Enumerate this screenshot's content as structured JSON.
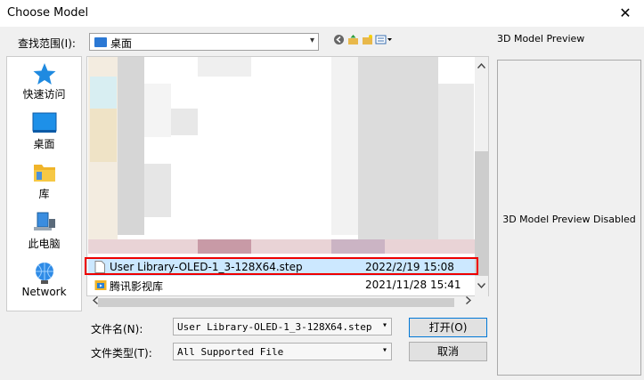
{
  "window": {
    "title": "Choose Model",
    "close_label": "✕"
  },
  "toolbar": {
    "look_in_label": "查找范围(I):",
    "look_in_value": "桌面"
  },
  "preview": {
    "title": "3D Model Preview",
    "status": "3D Model Preview Disabled"
  },
  "places": [
    {
      "label": "快速访问",
      "icon": "star-icon"
    },
    {
      "label": "桌面",
      "icon": "desktop-icon"
    },
    {
      "label": "库",
      "icon": "library-icon"
    },
    {
      "label": "此电脑",
      "icon": "computer-icon"
    },
    {
      "label": "Network",
      "icon": "network-icon"
    }
  ],
  "files": [
    {
      "name": "User Library-OLED-1_3-128X64.step",
      "date": "2022/2/19 15:08",
      "selected": true
    },
    {
      "name": "腾讯影视库",
      "date": "2021/11/28 15:41",
      "selected": false
    }
  ],
  "form": {
    "filename_label": "文件名(N):",
    "filename_value": "User Library-OLED-1_3-128X64.step",
    "filetype_label": "文件类型(T):",
    "filetype_value": "All Supported File",
    "open_label": "打开(O)",
    "cancel_label": "取消"
  }
}
